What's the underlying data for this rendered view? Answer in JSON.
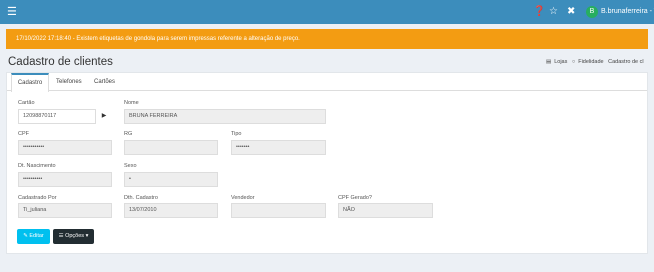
{
  "topbar": {
    "menu_icon": "hamburger-icon",
    "help_icon": "question-circle-icon",
    "star_icon": "star-icon",
    "tools_icon": "wrench-icon",
    "avatar_initial": "B",
    "user_name": "B.brunaferreira - T",
    "accent": "#3c8dbc"
  },
  "alert": {
    "text": "17/10/2022 17:18:40 - Existem etiquetas de gondola para serem impressas referente a alteração de preço.",
    "color": "#f39c12"
  },
  "page": {
    "title": "Cadastro de clientes",
    "breadcrumb": [
      "Lojas",
      "Fidelidade",
      "Cadastro de cl"
    ]
  },
  "tabs": [
    "Cadastro",
    "Telefones",
    "Cartões"
  ],
  "form": {
    "cartao_label": "Cartão",
    "cartao_value": "12098870117",
    "nome_label": "Nome",
    "nome_value": "BRUNA FERREIRA",
    "cpf_label": "CPF",
    "cpf_value": "•••••••••••",
    "rg_label": "RG",
    "rg_value": "",
    "tipo_label": "Tipo",
    "tipo_value": "•••••••",
    "nascimento_label": "Dt. Nascimento",
    "nascimento_value": "••••••••••",
    "sexo_label": "Sexo",
    "sexo_value": "•",
    "cadastrado_por_label": "Cadastrado Por",
    "cadastrado_por_value": "Ti_juliana",
    "dth_cadastro_label": "Dth. Cadastro",
    "dth_cadastro_value": "13/07/2010",
    "vendedor_label": "Vendedor",
    "vendedor_value": "",
    "cpf_gerado_label": "CPF Gerado?",
    "cpf_gerado_value": "NÃO"
  },
  "buttons": {
    "edit_label": "✎ Editar",
    "options_label": "☰ Opções ▾",
    "edit_color": "#00c0ef",
    "options_color": "#222d32"
  }
}
